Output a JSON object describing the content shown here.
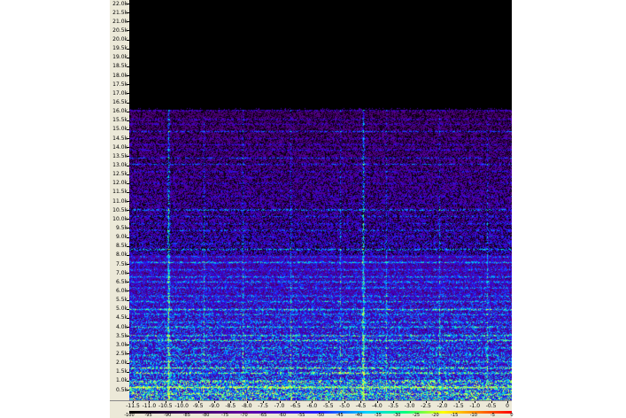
{
  "spectrogram": {
    "freq_labels": [
      "22.0k",
      "21.5k",
      "21.0k",
      "20.5k",
      "20.0k",
      "19.5k",
      "19.0k",
      "18.5k",
      "18.0k",
      "17.5k",
      "17.0k",
      "16.5k",
      "16.0k",
      "15.5k",
      "15.0k",
      "14.5k",
      "14.0k",
      "13.5k",
      "13.0k",
      "12.5k",
      "12.0k",
      "11.5k",
      "11.0k",
      "10.5k",
      "10.0k",
      "9.5k",
      "9.0k",
      "8.5k",
      "8.0k",
      "7.5k",
      "7.0k",
      "6.5k",
      "6.0k",
      "5.5k",
      "5.0k",
      "4.5k",
      "4.0k",
      "3.5k",
      "3.0k",
      "2.5k",
      "2.0k",
      "1.5k",
      "1.0k",
      "0.5k"
    ],
    "time_labels": [
      "-11.5",
      "-11.0",
      "-10.5",
      "-10.0",
      "-9.5",
      "-9.0",
      "-8.5",
      "-8.0",
      "-7.5",
      "-7.0",
      "-6.5",
      "-6.0",
      "-5.5",
      "-5.0",
      "-4.5",
      "-4.0",
      "-3.5",
      "-3.0",
      "-2.5",
      "-2.0",
      "-1.5",
      "-1.0",
      "-0.5",
      "0"
    ],
    "scale_labels": [
      "-100",
      "-95",
      "-90",
      "-85",
      "-80",
      "-75",
      "-70",
      "-65",
      "-60",
      "-55",
      "-50",
      "-45",
      "-40",
      "-35",
      "-30",
      "-25",
      "-20",
      "-15",
      "-10",
      "-5",
      "0"
    ],
    "colors": {
      "background": "#000000",
      "low": "#5a0080",
      "mid": "#2020ff",
      "high": "#00e0ff",
      "peak": "#ffff00"
    }
  }
}
